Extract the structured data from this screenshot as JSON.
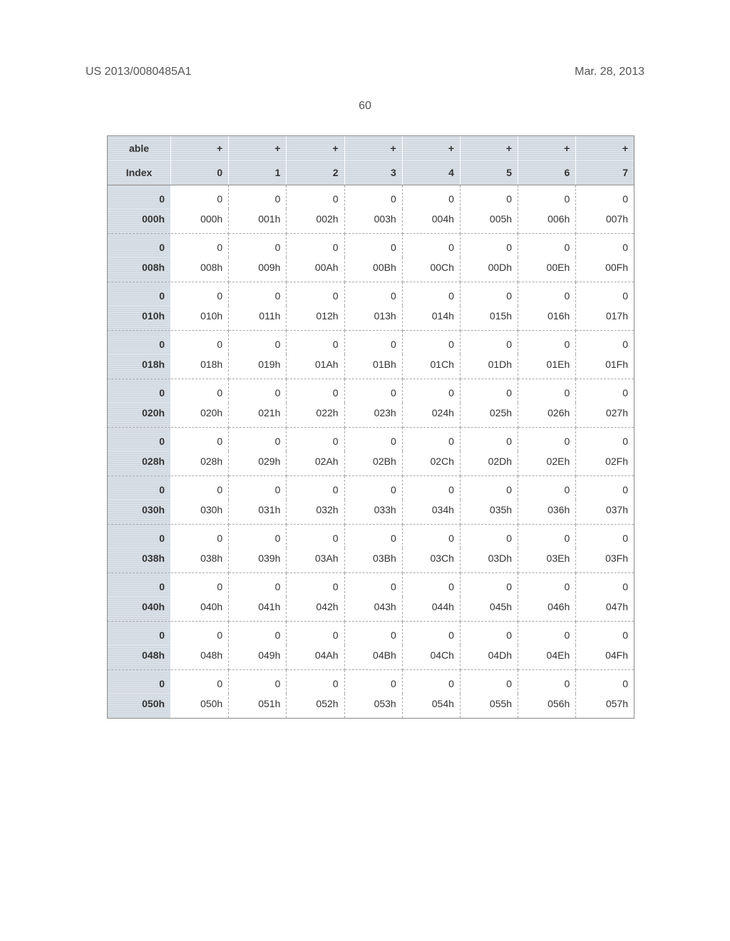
{
  "header": {
    "publication_number": "US 2013/0080485A1",
    "publication_date": "Mar. 28, 2013",
    "page_number": "60"
  },
  "table": {
    "header_top": {
      "index": "able",
      "cols": [
        "+",
        "+",
        "+",
        "+",
        "+",
        "+",
        "+",
        "+"
      ]
    },
    "header_bottom": {
      "index": "Index",
      "cols": [
        "0",
        "1",
        "2",
        "3",
        "4",
        "5",
        "6",
        "7"
      ]
    },
    "rows": [
      {
        "top": {
          "index": "0",
          "cells": [
            "0",
            "0",
            "0",
            "0",
            "0",
            "0",
            "0",
            "0"
          ]
        },
        "bottom": {
          "index": "000h",
          "cells": [
            "000h",
            "001h",
            "002h",
            "003h",
            "004h",
            "005h",
            "006h",
            "007h"
          ]
        }
      },
      {
        "top": {
          "index": "0",
          "cells": [
            "0",
            "0",
            "0",
            "0",
            "0",
            "0",
            "0",
            "0"
          ]
        },
        "bottom": {
          "index": "008h",
          "cells": [
            "008h",
            "009h",
            "00Ah",
            "00Bh",
            "00Ch",
            "00Dh",
            "00Eh",
            "00Fh"
          ]
        }
      },
      {
        "top": {
          "index": "0",
          "cells": [
            "0",
            "0",
            "0",
            "0",
            "0",
            "0",
            "0",
            "0"
          ]
        },
        "bottom": {
          "index": "010h",
          "cells": [
            "010h",
            "011h",
            "012h",
            "013h",
            "014h",
            "015h",
            "016h",
            "017h"
          ]
        }
      },
      {
        "top": {
          "index": "0",
          "cells": [
            "0",
            "0",
            "0",
            "0",
            "0",
            "0",
            "0",
            "0"
          ]
        },
        "bottom": {
          "index": "018h",
          "cells": [
            "018h",
            "019h",
            "01Ah",
            "01Bh",
            "01Ch",
            "01Dh",
            "01Eh",
            "01Fh"
          ]
        }
      },
      {
        "top": {
          "index": "0",
          "cells": [
            "0",
            "0",
            "0",
            "0",
            "0",
            "0",
            "0",
            "0"
          ]
        },
        "bottom": {
          "index": "020h",
          "cells": [
            "020h",
            "021h",
            "022h",
            "023h",
            "024h",
            "025h",
            "026h",
            "027h"
          ]
        }
      },
      {
        "top": {
          "index": "0",
          "cells": [
            "0",
            "0",
            "0",
            "0",
            "0",
            "0",
            "0",
            "0"
          ]
        },
        "bottom": {
          "index": "028h",
          "cells": [
            "028h",
            "029h",
            "02Ah",
            "02Bh",
            "02Ch",
            "02Dh",
            "02Eh",
            "02Fh"
          ]
        }
      },
      {
        "top": {
          "index": "0",
          "cells": [
            "0",
            "0",
            "0",
            "0",
            "0",
            "0",
            "0",
            "0"
          ]
        },
        "bottom": {
          "index": "030h",
          "cells": [
            "030h",
            "031h",
            "032h",
            "033h",
            "034h",
            "035h",
            "036h",
            "037h"
          ]
        }
      },
      {
        "top": {
          "index": "0",
          "cells": [
            "0",
            "0",
            "0",
            "0",
            "0",
            "0",
            "0",
            "0"
          ]
        },
        "bottom": {
          "index": "038h",
          "cells": [
            "038h",
            "039h",
            "03Ah",
            "03Bh",
            "03Ch",
            "03Dh",
            "03Eh",
            "03Fh"
          ]
        }
      },
      {
        "top": {
          "index": "0",
          "cells": [
            "0",
            "0",
            "0",
            "0",
            "0",
            "0",
            "0",
            "0"
          ]
        },
        "bottom": {
          "index": "040h",
          "cells": [
            "040h",
            "041h",
            "042h",
            "043h",
            "044h",
            "045h",
            "046h",
            "047h"
          ]
        }
      },
      {
        "top": {
          "index": "0",
          "cells": [
            "0",
            "0",
            "0",
            "0",
            "0",
            "0",
            "0",
            "0"
          ]
        },
        "bottom": {
          "index": "048h",
          "cells": [
            "048h",
            "049h",
            "04Ah",
            "04Bh",
            "04Ch",
            "04Dh",
            "04Eh",
            "04Fh"
          ]
        }
      },
      {
        "top": {
          "index": "0",
          "cells": [
            "0",
            "0",
            "0",
            "0",
            "0",
            "0",
            "0",
            "0"
          ]
        },
        "bottom": {
          "index": "050h",
          "cells": [
            "050h",
            "051h",
            "052h",
            "053h",
            "054h",
            "055h",
            "056h",
            "057h"
          ]
        }
      }
    ]
  }
}
